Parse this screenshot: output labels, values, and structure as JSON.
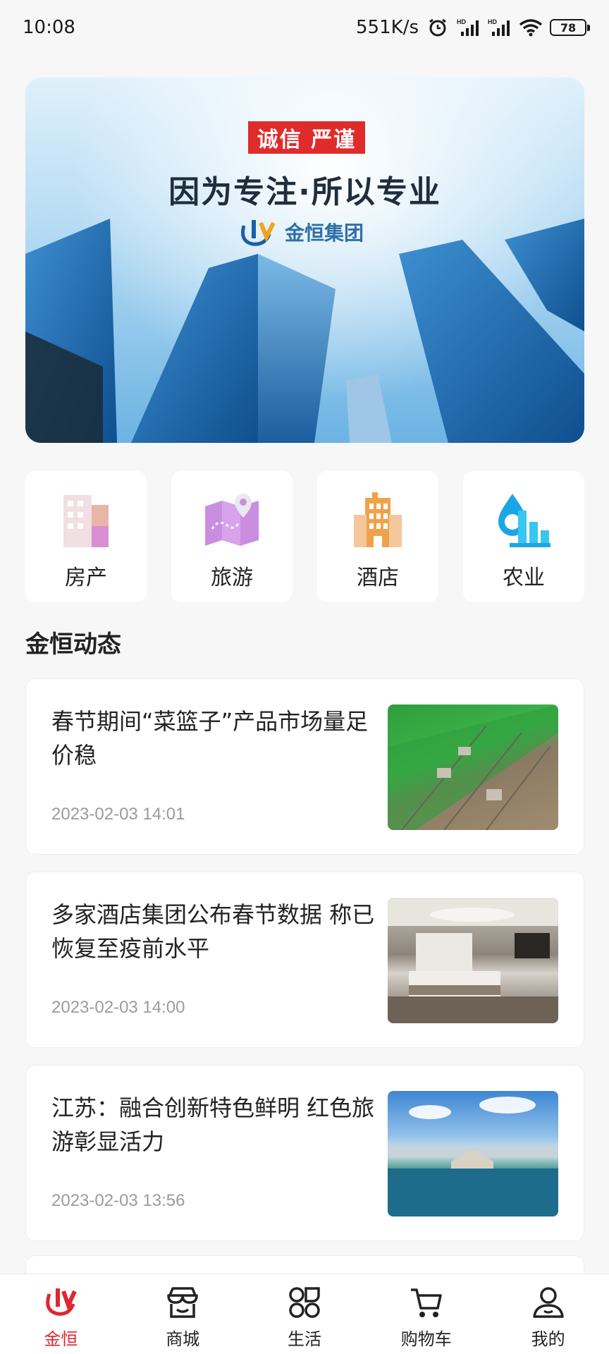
{
  "status_bar": {
    "time": "10:08",
    "net_speed": "551K/s",
    "battery": "78",
    "icons": [
      "alarm-icon",
      "hd-signal-icon",
      "hd-signal-icon",
      "wifi-icon",
      "battery-icon"
    ]
  },
  "banner": {
    "badge": "诚信  严谨",
    "slogan": "因为专注·所以专业",
    "logo_text": "金恒集团"
  },
  "categories": [
    {
      "label": "房产",
      "icon": "building-icon"
    },
    {
      "label": "旅游",
      "icon": "map-icon"
    },
    {
      "label": "酒店",
      "icon": "hotel-icon"
    },
    {
      "label": "农业",
      "icon": "agriculture-icon"
    }
  ],
  "section": {
    "title": "金恒动态"
  },
  "news": [
    {
      "title": "春节期间“菜篮子”产品市场量足价稳",
      "time": "2023-02-03 14:01",
      "thumb": "farm-image"
    },
    {
      "title": "多家酒店集团公布春节数据 称已恢复至疫前水平",
      "time": "2023-02-03 14:00",
      "thumb": "hotel-room-image"
    },
    {
      "title": "江苏：融合创新特色鲜明 红色旅游彰显活力",
      "time": "2023-02-03 13:56",
      "thumb": "lake-image"
    }
  ],
  "bottom_nav": [
    {
      "label": "金恒",
      "icon": "brand-logo-icon",
      "active": true
    },
    {
      "label": "商城",
      "icon": "shop-icon",
      "active": false
    },
    {
      "label": "生活",
      "icon": "apps-grid-icon",
      "active": false
    },
    {
      "label": "购物车",
      "icon": "cart-icon",
      "active": false
    },
    {
      "label": "我的",
      "icon": "user-icon",
      "active": false
    }
  ],
  "colors": {
    "accent": "#e0262e",
    "badge_red": "#e02b2b",
    "text_primary": "#222222",
    "text_muted": "#9b9b9b"
  }
}
